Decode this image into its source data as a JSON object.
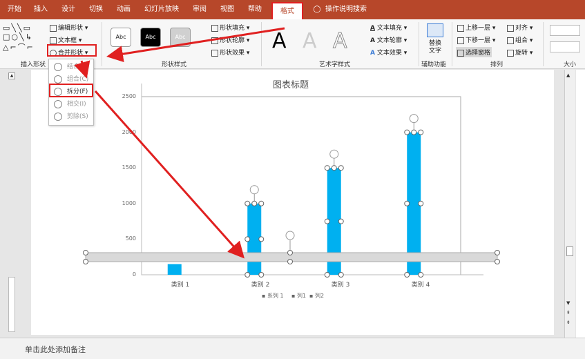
{
  "tabs": [
    "开始",
    "插入",
    "设计",
    "切换",
    "动画",
    "幻灯片放映",
    "审阅",
    "视图",
    "帮助",
    "格式"
  ],
  "tell_me": "操作说明搜索",
  "ribbon": {
    "insert_shapes": {
      "label": "插入形状",
      "edit_shape": "编辑形状",
      "textbox": "文本框",
      "merge_shapes": "合并形状"
    },
    "shape_styles": {
      "label": "形状样式",
      "sample": "Abc",
      "fill": "形状填充",
      "outline": "形状轮廓",
      "effect": "形状效果"
    },
    "wordart": {
      "label": "艺术字样式",
      "fill": "文本填充",
      "outline": "文本轮廓",
      "effect": "文本效果",
      "letter": "A"
    },
    "accessibility": {
      "label": "辅助功能",
      "alt_text": "替换文字"
    },
    "arrange": {
      "label": "排列",
      "bring_forward": "上移一层",
      "send_backward": "下移一层",
      "selection_pane": "选择窗格",
      "align": "对齐",
      "group": "组合",
      "rotate": "旋转"
    },
    "size": {
      "label": "大小"
    }
  },
  "merge_menu": [
    "结合(U)",
    "组合(C)",
    "拆分(F)",
    "相交(I)",
    "剪除(S)"
  ],
  "notes_placeholder": "单击此处添加备注",
  "chart_data": {
    "type": "bar",
    "title": "图表标题",
    "categories": [
      "类别 1",
      "类别 2",
      "类别 3",
      "类别 4"
    ],
    "values": [
      150,
      1000,
      1500,
      2000
    ],
    "yticks": [
      "2500",
      "2000",
      "1500",
      "1000",
      "500",
      "0"
    ],
    "ylim": [
      0,
      2500
    ],
    "legend": [
      "系列 1",
      "列1",
      "列2"
    ],
    "bar_color": "#00b0f0"
  },
  "colors": {
    "accent": "#b7472a",
    "highlight": "#e02020"
  }
}
